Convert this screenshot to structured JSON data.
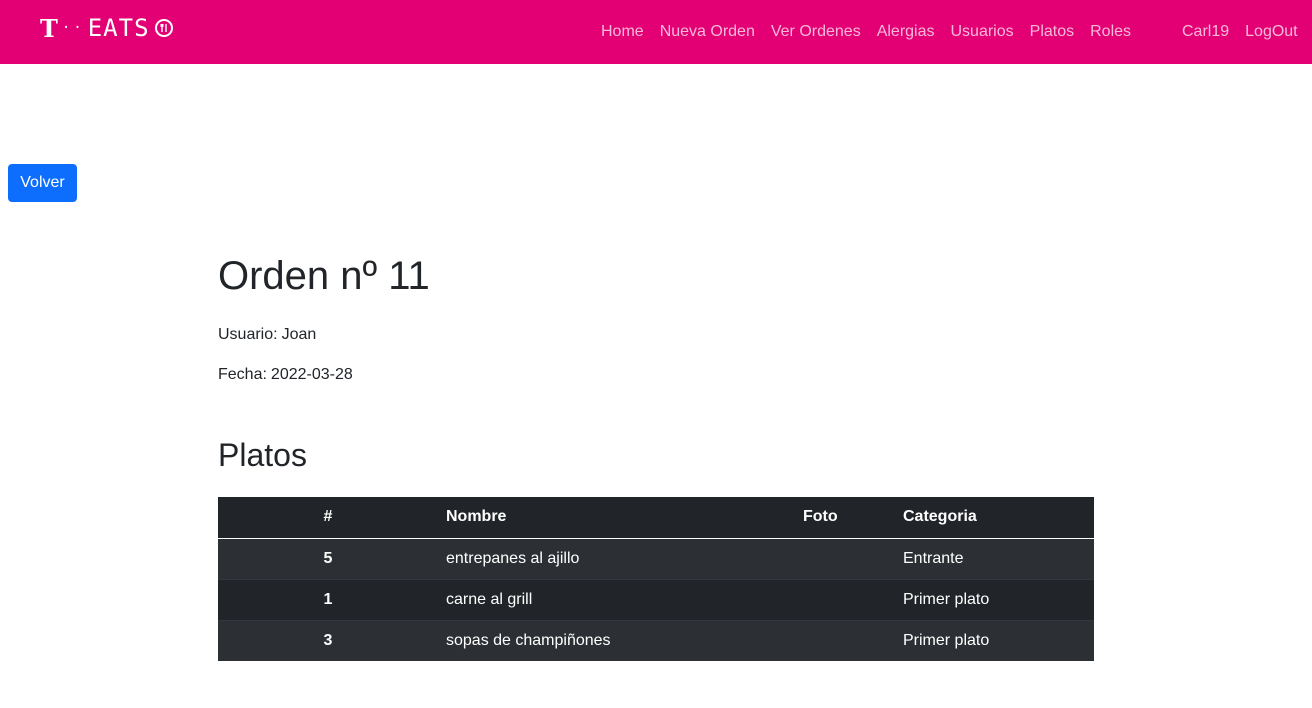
{
  "brand": {
    "t": "T",
    "dots": "··",
    "name": "EATS",
    "icon": "restaurant-icon"
  },
  "nav": {
    "items": [
      "Home",
      "Nueva Orden",
      "Ver Ordenes",
      "Alergias",
      "Usuarios",
      "Platos",
      "Roles"
    ],
    "right": [
      "Carl19",
      "LogOut"
    ]
  },
  "back_button": "Volver",
  "order": {
    "title": "Orden nº 11",
    "user_label": "Usuario:",
    "user": "Joan",
    "date_label": "Fecha:",
    "date": "2022-03-28"
  },
  "dishes_section": {
    "title": "Platos",
    "headers": [
      "#",
      "Nombre",
      "Foto",
      "Categoria"
    ],
    "rows": [
      {
        "id": "5",
        "name": "entrepanes al ajillo",
        "photo": "",
        "category": "Entrante"
      },
      {
        "id": "1",
        "name": "carne al grill",
        "photo": "",
        "category": "Primer plato"
      },
      {
        "id": "3",
        "name": "sopas de champiñones",
        "photo": "",
        "category": "Primer plato"
      }
    ]
  },
  "colors": {
    "navbar": "#e20074",
    "primary": "#0d6efd",
    "table_dark": "#212529",
    "table_stripe": "#2c3034"
  }
}
